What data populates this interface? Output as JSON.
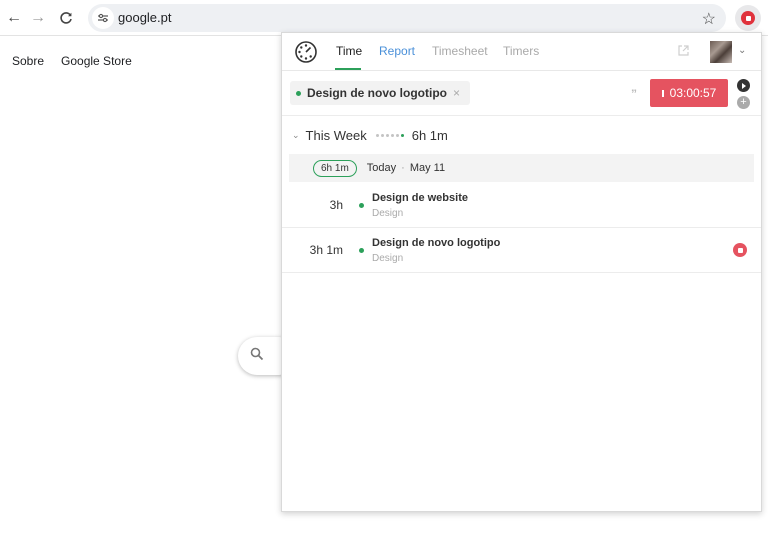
{
  "browser": {
    "url": "google.pt",
    "colors": {
      "extension_accent": "#e0323c"
    }
  },
  "google_page": {
    "links": [
      "Sobre",
      "Google Store"
    ]
  },
  "popup": {
    "tabs": [
      {
        "label": "Time",
        "active": true
      },
      {
        "label": "Report",
        "active": false
      },
      {
        "label": "Timesheet",
        "active": false
      },
      {
        "label": "Timers",
        "active": false
      }
    ],
    "current": {
      "task": "Design de novo logotipo",
      "timer": "03:00:57"
    },
    "week": {
      "label": "This Week",
      "total": "6h 1m"
    },
    "day": {
      "badge": "6h 1m",
      "label": "Today",
      "date": "May 11"
    },
    "entries": [
      {
        "duration": "3h",
        "title": "Design de website",
        "project": "Design",
        "running": false
      },
      {
        "duration": "3h 1m",
        "title": "Design de novo logotipo",
        "project": "Design",
        "running": true
      }
    ],
    "colors": {
      "accent_green": "#2ca05a",
      "timer_red": "#e55360",
      "link_blue": "#4a90d9"
    }
  }
}
